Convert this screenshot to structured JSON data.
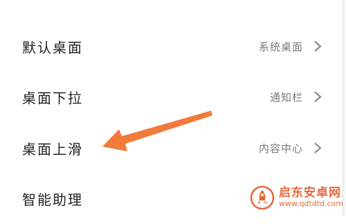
{
  "settings": {
    "rows": [
      {
        "label": "默认桌面",
        "value": "系统桌面"
      },
      {
        "label": "桌面下拉",
        "value": "通知栏"
      },
      {
        "label": "桌面上滑",
        "value": "内容中心"
      },
      {
        "label": "智能助理",
        "value": ""
      }
    ]
  },
  "icons": {
    "chevron": "chevron-right-icon",
    "annotation": "orange-arrow-pointer",
    "watermark_logo": "rocket-circle-logo"
  },
  "colors": {
    "arrow": "#f27a3a",
    "label_text": "#222222",
    "value_text": "#7a7a7a",
    "chevron": "#8a8a8a",
    "watermark": "#e8673c"
  },
  "watermark": {
    "name": "启东安卓网",
    "url": "www.qdtdtd.com"
  }
}
